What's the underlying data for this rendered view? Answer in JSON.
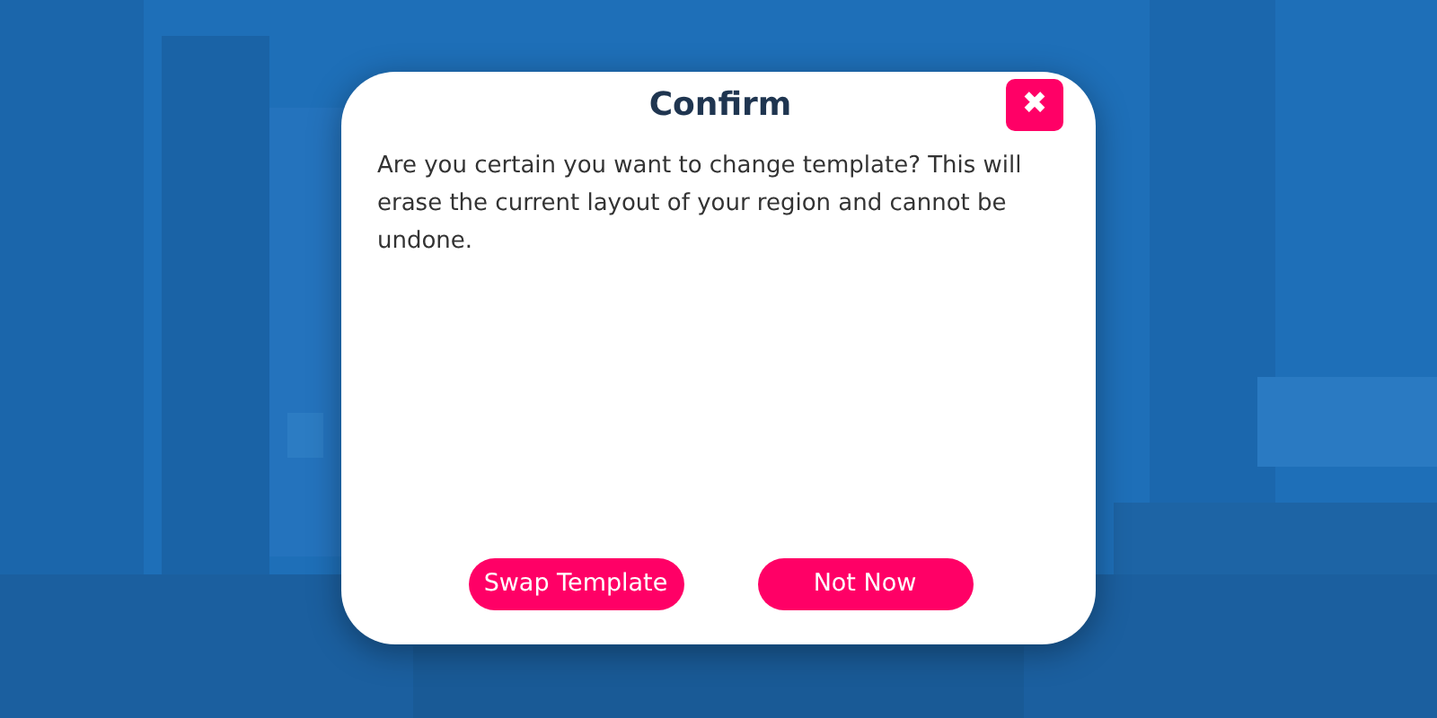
{
  "dialog": {
    "title": "Confirm",
    "close_icon": "✖",
    "message": "Are you certain you want to change template? This will erase the current layout of your region and cannot be undone.",
    "buttons": [
      {
        "label": "Swap Template"
      },
      {
        "label": "Not Now"
      }
    ]
  }
}
